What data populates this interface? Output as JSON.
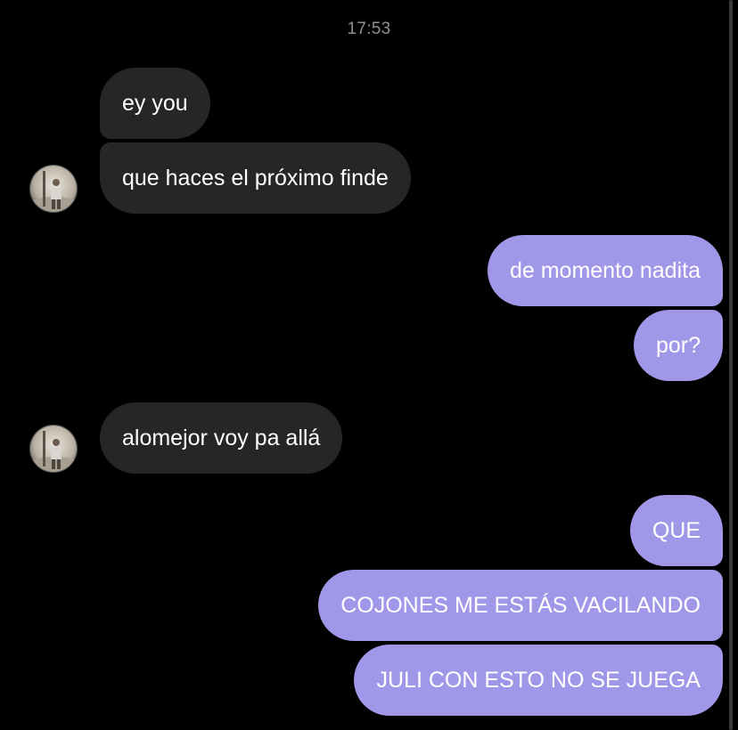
{
  "conversation": {
    "timestamp": "17:53",
    "messages": [
      {
        "sender": "them",
        "text": "ey you"
      },
      {
        "sender": "them",
        "text": "que haces el próximo finde"
      },
      {
        "sender": "me",
        "text": "de momento nadita"
      },
      {
        "sender": "me",
        "text": "por?"
      },
      {
        "sender": "them",
        "text": "alomejor voy pa allá"
      },
      {
        "sender": "me",
        "text": "QUE"
      },
      {
        "sender": "me",
        "text": "COJONES ME ESTÁS VACILANDO"
      },
      {
        "sender": "me",
        "text": "JULI CON ESTO NO SE JUEGA"
      }
    ]
  },
  "colors": {
    "background": "#000000",
    "incoming_bubble": "#262626",
    "outgoing_bubble": "#a197e8",
    "text": "#ffffff",
    "timestamp": "#8e8e93"
  },
  "icons": {
    "avatar": "avatar-photo"
  }
}
